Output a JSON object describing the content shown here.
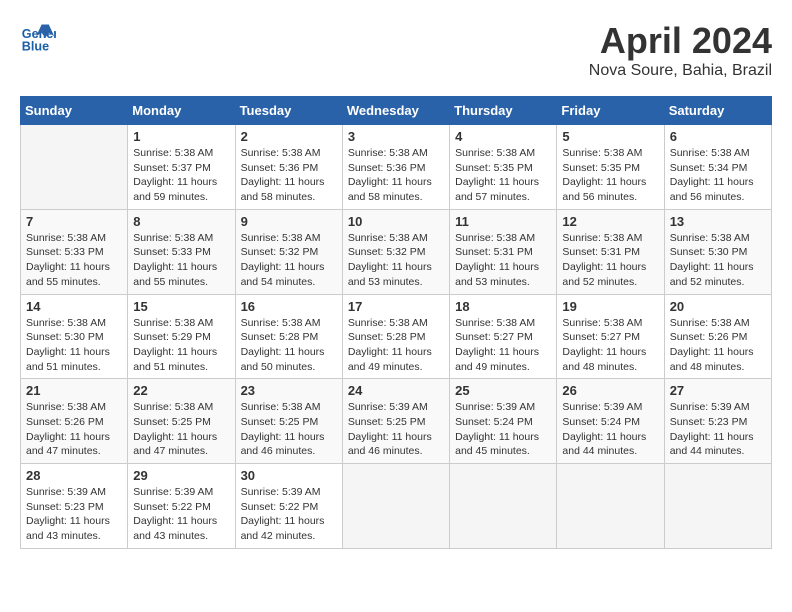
{
  "header": {
    "logo_line1": "General",
    "logo_line2": "Blue",
    "month_year": "April 2024",
    "location": "Nova Soure, Bahia, Brazil"
  },
  "days_of_week": [
    "Sunday",
    "Monday",
    "Tuesday",
    "Wednesday",
    "Thursday",
    "Friday",
    "Saturday"
  ],
  "weeks": [
    [
      {
        "day": "",
        "info": ""
      },
      {
        "day": "1",
        "info": "Sunrise: 5:38 AM\nSunset: 5:37 PM\nDaylight: 11 hours\nand 59 minutes."
      },
      {
        "day": "2",
        "info": "Sunrise: 5:38 AM\nSunset: 5:36 PM\nDaylight: 11 hours\nand 58 minutes."
      },
      {
        "day": "3",
        "info": "Sunrise: 5:38 AM\nSunset: 5:36 PM\nDaylight: 11 hours\nand 58 minutes."
      },
      {
        "day": "4",
        "info": "Sunrise: 5:38 AM\nSunset: 5:35 PM\nDaylight: 11 hours\nand 57 minutes."
      },
      {
        "day": "5",
        "info": "Sunrise: 5:38 AM\nSunset: 5:35 PM\nDaylight: 11 hours\nand 56 minutes."
      },
      {
        "day": "6",
        "info": "Sunrise: 5:38 AM\nSunset: 5:34 PM\nDaylight: 11 hours\nand 56 minutes."
      }
    ],
    [
      {
        "day": "7",
        "info": "Sunrise: 5:38 AM\nSunset: 5:33 PM\nDaylight: 11 hours\nand 55 minutes."
      },
      {
        "day": "8",
        "info": "Sunrise: 5:38 AM\nSunset: 5:33 PM\nDaylight: 11 hours\nand 55 minutes."
      },
      {
        "day": "9",
        "info": "Sunrise: 5:38 AM\nSunset: 5:32 PM\nDaylight: 11 hours\nand 54 minutes."
      },
      {
        "day": "10",
        "info": "Sunrise: 5:38 AM\nSunset: 5:32 PM\nDaylight: 11 hours\nand 53 minutes."
      },
      {
        "day": "11",
        "info": "Sunrise: 5:38 AM\nSunset: 5:31 PM\nDaylight: 11 hours\nand 53 minutes."
      },
      {
        "day": "12",
        "info": "Sunrise: 5:38 AM\nSunset: 5:31 PM\nDaylight: 11 hours\nand 52 minutes."
      },
      {
        "day": "13",
        "info": "Sunrise: 5:38 AM\nSunset: 5:30 PM\nDaylight: 11 hours\nand 52 minutes."
      }
    ],
    [
      {
        "day": "14",
        "info": "Sunrise: 5:38 AM\nSunset: 5:30 PM\nDaylight: 11 hours\nand 51 minutes."
      },
      {
        "day": "15",
        "info": "Sunrise: 5:38 AM\nSunset: 5:29 PM\nDaylight: 11 hours\nand 51 minutes."
      },
      {
        "day": "16",
        "info": "Sunrise: 5:38 AM\nSunset: 5:28 PM\nDaylight: 11 hours\nand 50 minutes."
      },
      {
        "day": "17",
        "info": "Sunrise: 5:38 AM\nSunset: 5:28 PM\nDaylight: 11 hours\nand 49 minutes."
      },
      {
        "day": "18",
        "info": "Sunrise: 5:38 AM\nSunset: 5:27 PM\nDaylight: 11 hours\nand 49 minutes."
      },
      {
        "day": "19",
        "info": "Sunrise: 5:38 AM\nSunset: 5:27 PM\nDaylight: 11 hours\nand 48 minutes."
      },
      {
        "day": "20",
        "info": "Sunrise: 5:38 AM\nSunset: 5:26 PM\nDaylight: 11 hours\nand 48 minutes."
      }
    ],
    [
      {
        "day": "21",
        "info": "Sunrise: 5:38 AM\nSunset: 5:26 PM\nDaylight: 11 hours\nand 47 minutes."
      },
      {
        "day": "22",
        "info": "Sunrise: 5:38 AM\nSunset: 5:25 PM\nDaylight: 11 hours\nand 47 minutes."
      },
      {
        "day": "23",
        "info": "Sunrise: 5:38 AM\nSunset: 5:25 PM\nDaylight: 11 hours\nand 46 minutes."
      },
      {
        "day": "24",
        "info": "Sunrise: 5:39 AM\nSunset: 5:25 PM\nDaylight: 11 hours\nand 46 minutes."
      },
      {
        "day": "25",
        "info": "Sunrise: 5:39 AM\nSunset: 5:24 PM\nDaylight: 11 hours\nand 45 minutes."
      },
      {
        "day": "26",
        "info": "Sunrise: 5:39 AM\nSunset: 5:24 PM\nDaylight: 11 hours\nand 44 minutes."
      },
      {
        "day": "27",
        "info": "Sunrise: 5:39 AM\nSunset: 5:23 PM\nDaylight: 11 hours\nand 44 minutes."
      }
    ],
    [
      {
        "day": "28",
        "info": "Sunrise: 5:39 AM\nSunset: 5:23 PM\nDaylight: 11 hours\nand 43 minutes."
      },
      {
        "day": "29",
        "info": "Sunrise: 5:39 AM\nSunset: 5:22 PM\nDaylight: 11 hours\nand 43 minutes."
      },
      {
        "day": "30",
        "info": "Sunrise: 5:39 AM\nSunset: 5:22 PM\nDaylight: 11 hours\nand 42 minutes."
      },
      {
        "day": "",
        "info": ""
      },
      {
        "day": "",
        "info": ""
      },
      {
        "day": "",
        "info": ""
      },
      {
        "day": "",
        "info": ""
      }
    ]
  ]
}
